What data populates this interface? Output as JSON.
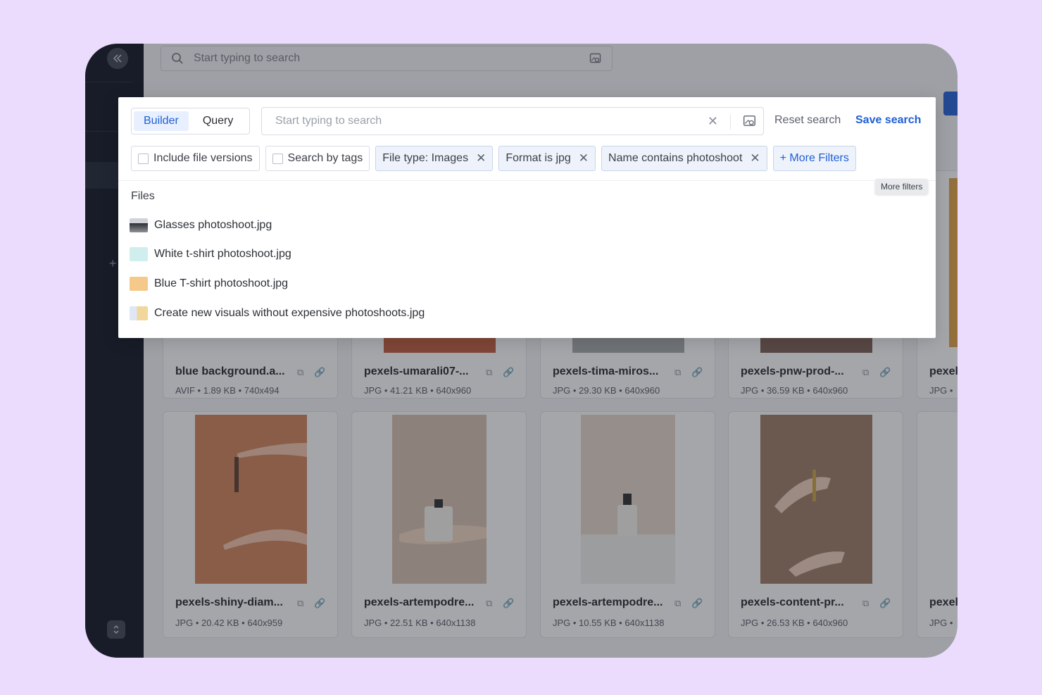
{
  "background": {
    "top_search_placeholder": "Start typing to search",
    "cards_row1": [
      {
        "name": "blue background.a...",
        "meta": "AVIF • 1.89 KB • 740x494"
      },
      {
        "name": "pexels-umarali07-...",
        "meta": "JPG • 41.21 KB • 640x960"
      },
      {
        "name": "pexels-tima-miros...",
        "meta": "JPG • 29.30 KB • 640x960"
      },
      {
        "name": "pexels-pnw-prod-...",
        "meta": "JPG • 36.59 KB • 640x960"
      },
      {
        "name": "pexel",
        "meta": "JPG • "
      }
    ],
    "cards_row2": [
      {
        "name": "pexels-shiny-diam...",
        "meta": "JPG • 20.42 KB • 640x959"
      },
      {
        "name": "pexels-artempodre...",
        "meta": "JPG • 22.51 KB • 640x1138"
      },
      {
        "name": "pexels-artempodre...",
        "meta": "JPG • 10.55 KB • 640x1138"
      },
      {
        "name": "pexels-content-pr...",
        "meta": "JPG • 26.53 KB • 640x960"
      },
      {
        "name": "pexel",
        "meta": "JPG • "
      }
    ]
  },
  "popup": {
    "mode_builder": "Builder",
    "mode_query": "Query",
    "search_placeholder": "Start typing to search",
    "reset_label": "Reset search",
    "save_label": "Save search",
    "filters": {
      "include_versions": "Include file versions",
      "search_by_tags": "Search by tags",
      "file_type": "File type: Images",
      "format": "Format is jpg",
      "name_contains": "Name contains photoshoot",
      "more_filters": "+ More Filters"
    },
    "tooltip": "More filters",
    "files_heading": "Files",
    "files": [
      {
        "name": "Glasses photoshoot.jpg"
      },
      {
        "name": "White t-shirt photoshoot.jpg"
      },
      {
        "name": "Blue T-shirt photoshoot.jpg"
      },
      {
        "name": "Create new visuals without expensive photoshoots.jpg"
      }
    ]
  },
  "colors": {
    "accent": "#1f5fd6",
    "sidebar": "#0b1220",
    "page_bg": "#ebdcfd"
  }
}
